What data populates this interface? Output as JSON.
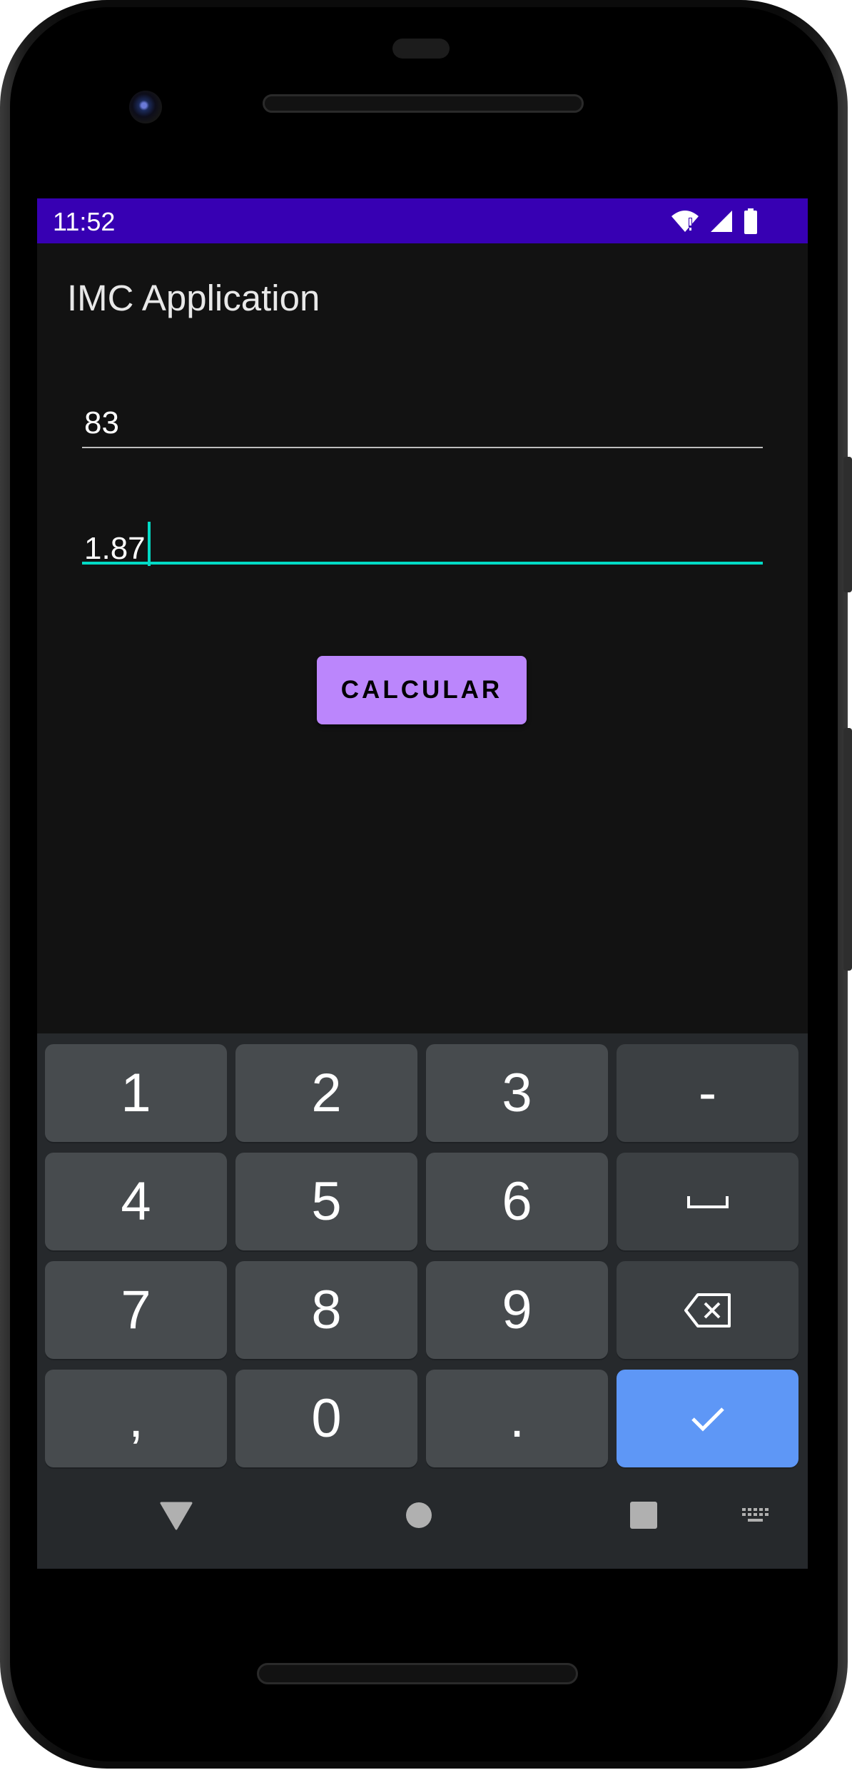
{
  "status_bar": {
    "time": "11:52",
    "icons": [
      "wifi-icon",
      "signal-icon",
      "battery-icon"
    ],
    "background": "#3700b3"
  },
  "app": {
    "title": "IMC Application",
    "weight_field": {
      "value": "83"
    },
    "height_field": {
      "value": "1.87",
      "focused": true
    },
    "calculate_button": {
      "label": "CALCULAR",
      "color": "#bb86fc"
    }
  },
  "keyboard": {
    "rows": [
      [
        "1",
        "2",
        "3",
        "-"
      ],
      [
        "4",
        "5",
        "6",
        "space-icon"
      ],
      [
        "7",
        "8",
        "9",
        "backspace-icon"
      ],
      [
        ",",
        "0",
        ".",
        "check-icon"
      ]
    ],
    "accent": "#5e97f6"
  },
  "nav_bar": {
    "icons": [
      "back-icon",
      "home-icon",
      "recents-icon",
      "keyboard-switch-icon"
    ]
  }
}
